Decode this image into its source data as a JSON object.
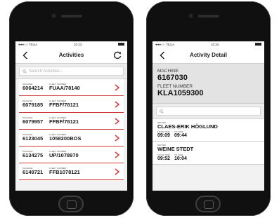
{
  "activities_screen": {
    "status": {
      "carrier": "●●●○○ TELIA",
      "time": "10:33"
    },
    "nav": {
      "title": "Activities",
      "back_icon": "chevron-left-icon",
      "refresh_icon": "refresh-icon"
    },
    "search": {
      "placeholder": "Search Activities..."
    },
    "column_labels": {
      "machine": "MACHINE",
      "fleet": "FLEET NUMBER"
    },
    "rows": [
      {
        "machine": "6064214",
        "fleet": "FUAA/78140"
      },
      {
        "machine": "6079185",
        "fleet": "FFBF/78121"
      },
      {
        "machine": "6079957",
        "fleet": "FFBF/78121"
      },
      {
        "machine": "6123045",
        "fleet": "1058200BOS"
      },
      {
        "machine": "6134275",
        "fleet": "UP/1078970"
      },
      {
        "machine": "6149721",
        "fleet": "FFB1078121"
      }
    ]
  },
  "detail_screen": {
    "status": {
      "carrier": "●●●○○ TELIA",
      "time": "10:34"
    },
    "nav": {
      "title": "Activity Detail",
      "back_icon": "chevron-left-icon"
    },
    "machine_label": "MACHINE",
    "machine_value": "6167030",
    "fleet_label": "FLEET NUMBER",
    "fleet_value": "KLA1059300",
    "search": {
      "placeholder": ""
    },
    "labels": {
      "driver": "DRIVER",
      "from_time": "FROM TIME",
      "to_time": "TO TIME"
    },
    "drivers": [
      {
        "name": "CLAES-ERIK HÖGLUND",
        "from": "09:09",
        "to": "09:44"
      },
      {
        "name": "WEINE STEDT",
        "from": "09:52",
        "to": "10:04"
      }
    ]
  },
  "colors": {
    "accent": "#d33b3b",
    "phone": "#101010",
    "screen_bg": "#f2f2f2"
  }
}
